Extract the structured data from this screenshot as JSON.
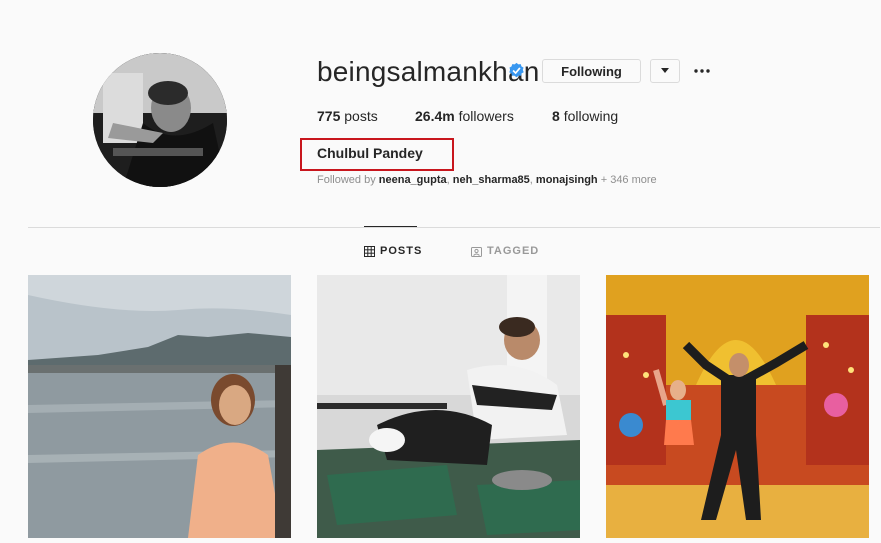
{
  "profile": {
    "username": "beingsalmankhan",
    "full_name": "Chulbul Pandey",
    "following_button_label": "Following",
    "stats": {
      "posts_count": "775",
      "posts_label": "posts",
      "followers_count": "26.4m",
      "followers_label": "followers",
      "following_count": "8",
      "following_label": "following"
    },
    "followed_by": {
      "prefix": "Followed by",
      "users": [
        "neena_gupta",
        "neh_sharma85",
        "monajsingh"
      ],
      "separator": ", ",
      "more": "+ 346 more"
    }
  },
  "icons": {
    "verified": "verified-badge-icon",
    "dropdown": "caret-down-icon",
    "more": "more-options-icon",
    "grid": "grid-icon",
    "tagged": "tagged-icon"
  },
  "tabs": [
    {
      "label": "POSTS",
      "active": true
    },
    {
      "label": "TAGGED",
      "active": false
    }
  ],
  "colors": {
    "accent_blue": "#3897f0",
    "highlight_red": "#c8161d",
    "text": "#262626",
    "muted": "#8e8e8e"
  }
}
